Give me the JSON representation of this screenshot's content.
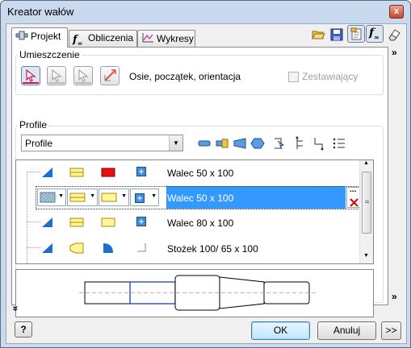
{
  "window": {
    "title": "Kreator wałów",
    "close_label": "x"
  },
  "tabs": [
    {
      "label": "Projekt",
      "active": true
    },
    {
      "label": "Obliczenia",
      "active": false
    },
    {
      "label": "Wykresy",
      "active": false
    }
  ],
  "placement": {
    "group_label": "Umieszczenie",
    "mode_text": "Osie, początek, orientacja",
    "assembling_label": "Zestawiający",
    "assembling_checked": false
  },
  "profile": {
    "group_label": "Profile",
    "selected": "Profile"
  },
  "sections": [
    {
      "text": "Walec 50 x 100"
    },
    {
      "text": "Walec 50 x 100"
    },
    {
      "text": "Walec 80 x 100"
    },
    {
      "text": "Stożek 100/ 65 x 100"
    }
  ],
  "selected_row": 1,
  "buttons": {
    "ok": "OK",
    "cancel": "Anuluj",
    "more": ">>",
    "help": "?"
  },
  "colors": {
    "accent": "#3399ff",
    "tool_blue": "#1c6fd1",
    "feature_red": "#e81010",
    "feature_yellow": "#fff59a"
  }
}
